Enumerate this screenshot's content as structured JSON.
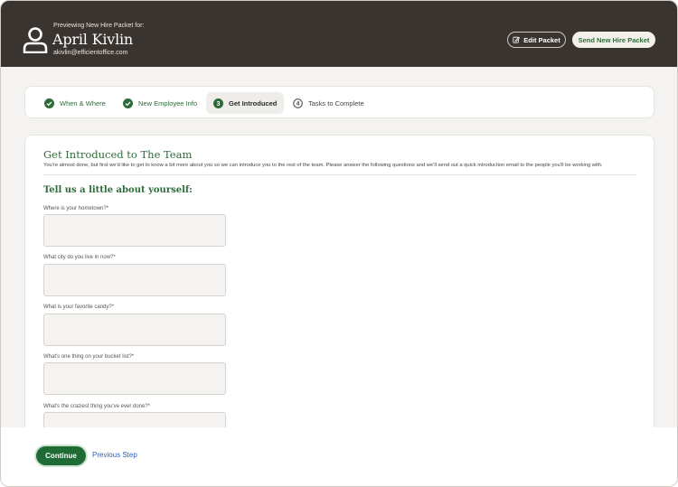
{
  "header": {
    "preview_label": "Previewing New Hire Packet for:",
    "name": "April Kivlin",
    "email": "akivlin@efficientoffice.com",
    "edit_label": "Edit Packet",
    "send_label": "Send New Hire Packet"
  },
  "steps": [
    {
      "label": "When & Where",
      "state": "done"
    },
    {
      "label": "New Employee Info",
      "state": "done"
    },
    {
      "label": "Get Introduced",
      "state": "active",
      "number": "3"
    },
    {
      "label": "Tasks to Complete",
      "state": "todo",
      "number": "4"
    }
  ],
  "card": {
    "title": "Get Introduced to The Team",
    "description": "You're almost done, but first we'd like to get to know a bit more about you so we can introduce you to the rest of the team. Please answer the following questions and we'll send out a quick introduction email to the people you'll be working with.",
    "section_title": "Tell us a little about yourself:",
    "questions": [
      {
        "label": "Where is your hometown?*",
        "value": ""
      },
      {
        "label": "What city do you live in now?*",
        "value": ""
      },
      {
        "label": "What is your favorite candy?*",
        "value": ""
      },
      {
        "label": "What's one thing on your bucket list?*",
        "value": ""
      },
      {
        "label": "What's the craziest thing you've ever done?*",
        "value": ""
      }
    ]
  },
  "footer": {
    "continue_label": "Continue",
    "previous_label": "Previous Step"
  },
  "colors": {
    "header_bg": "#3a3431",
    "accent_green": "#2f6b3a",
    "button_green": "#1e6b35",
    "link_blue": "#2d5fb8"
  }
}
